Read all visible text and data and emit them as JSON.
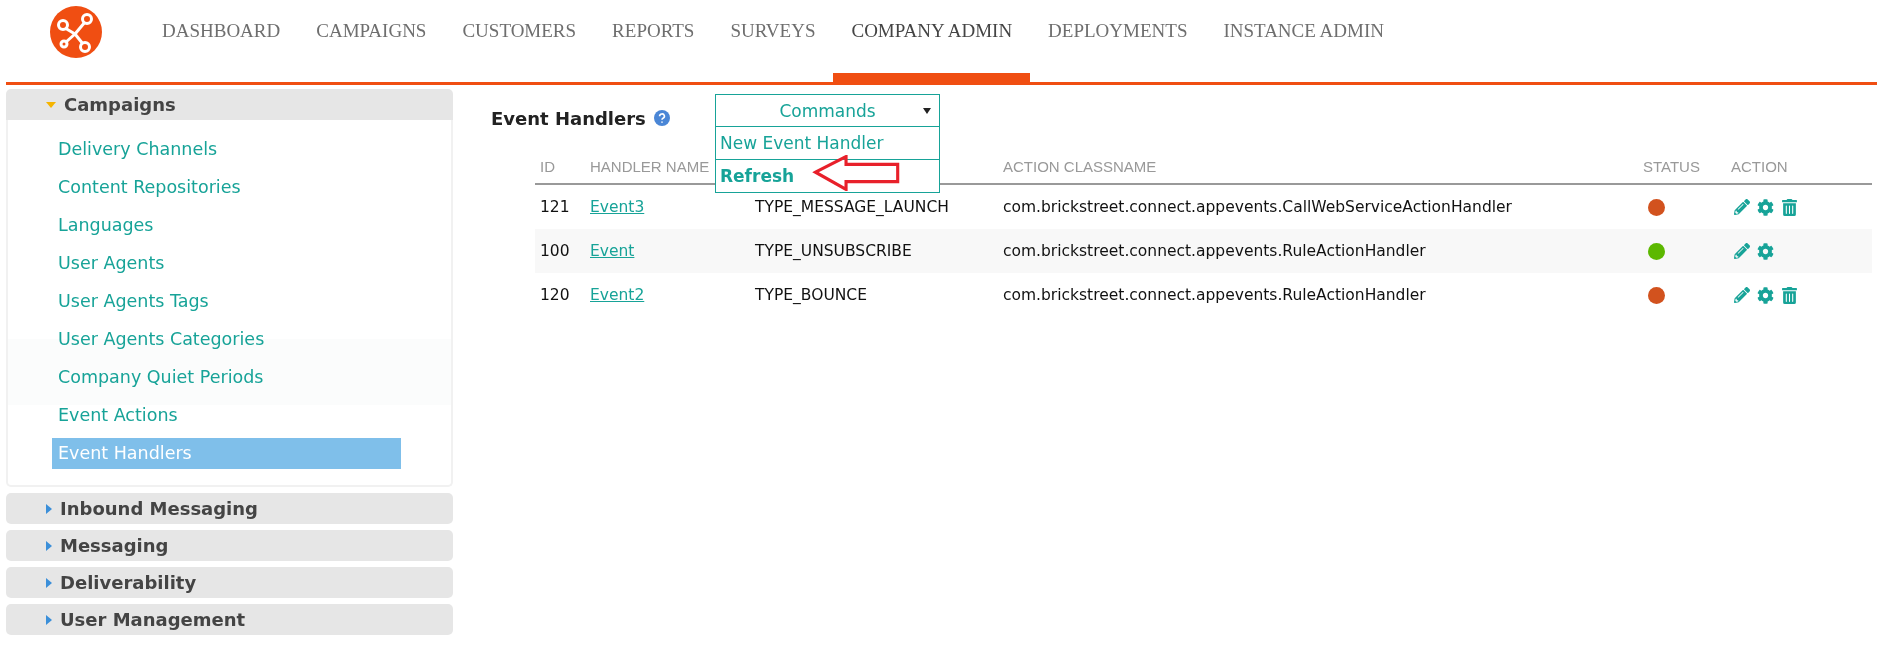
{
  "nav": {
    "items": [
      {
        "label": "DASHBOARD",
        "selected": false
      },
      {
        "label": "CAMPAIGNS",
        "selected": false
      },
      {
        "label": "CUSTOMERS",
        "selected": false
      },
      {
        "label": "REPORTS",
        "selected": false
      },
      {
        "label": "SURVEYS",
        "selected": false
      },
      {
        "label": "COMPANY ADMIN",
        "selected": true
      },
      {
        "label": "DEPLOYMENTS",
        "selected": false
      },
      {
        "label": "INSTANCE ADMIN",
        "selected": false
      }
    ]
  },
  "sidebar": {
    "sections": [
      {
        "label": "Campaigns",
        "expanded": true,
        "items": [
          {
            "label": "Delivery Channels",
            "selected": false
          },
          {
            "label": "Content Repositories",
            "selected": false
          },
          {
            "label": "Languages",
            "selected": false
          },
          {
            "label": "User Agents",
            "selected": false
          },
          {
            "label": "User Agents Tags",
            "selected": false
          },
          {
            "label": "User Agents Categories",
            "selected": false
          },
          {
            "label": "Company Quiet Periods",
            "selected": false
          },
          {
            "label": "Event Actions",
            "selected": false
          },
          {
            "label": "Event Handlers",
            "selected": true
          }
        ]
      },
      {
        "label": "Inbound Messaging",
        "expanded": false
      },
      {
        "label": "Messaging",
        "expanded": false
      },
      {
        "label": "Deliverability",
        "expanded": false
      },
      {
        "label": "User Management",
        "expanded": false
      }
    ]
  },
  "page": {
    "title": "Event Handlers"
  },
  "commands": {
    "label": "Commands",
    "items": [
      {
        "label": "New Event Handler",
        "highlighted": false
      },
      {
        "label": "Refresh",
        "highlighted": true
      }
    ]
  },
  "table": {
    "columns": [
      "ID",
      "HANDLER NAME",
      "ACTION CLASSNAME",
      "STATUS",
      "ACTION"
    ],
    "rows": [
      {
        "id": "121",
        "name": "Event3",
        "type": "TYPE_MESSAGE_LAUNCH",
        "classname": "com.brickstreet.connect.appevents.CallWebServiceActionHandler",
        "color": "#d2521e",
        "deletable": true
      },
      {
        "id": "100",
        "name": "Event",
        "type": "TYPE_UNSUBSCRIBE",
        "classname": "com.brickstreet.connect.appevents.RuleActionHandler",
        "color": "#5cb800",
        "deletable": false
      },
      {
        "id": "120",
        "name": "Event2",
        "type": "TYPE_BOUNCE",
        "classname": "com.brickstreet.connect.appevents.RuleActionHandler",
        "color": "#d2521e",
        "deletable": true
      }
    ]
  }
}
